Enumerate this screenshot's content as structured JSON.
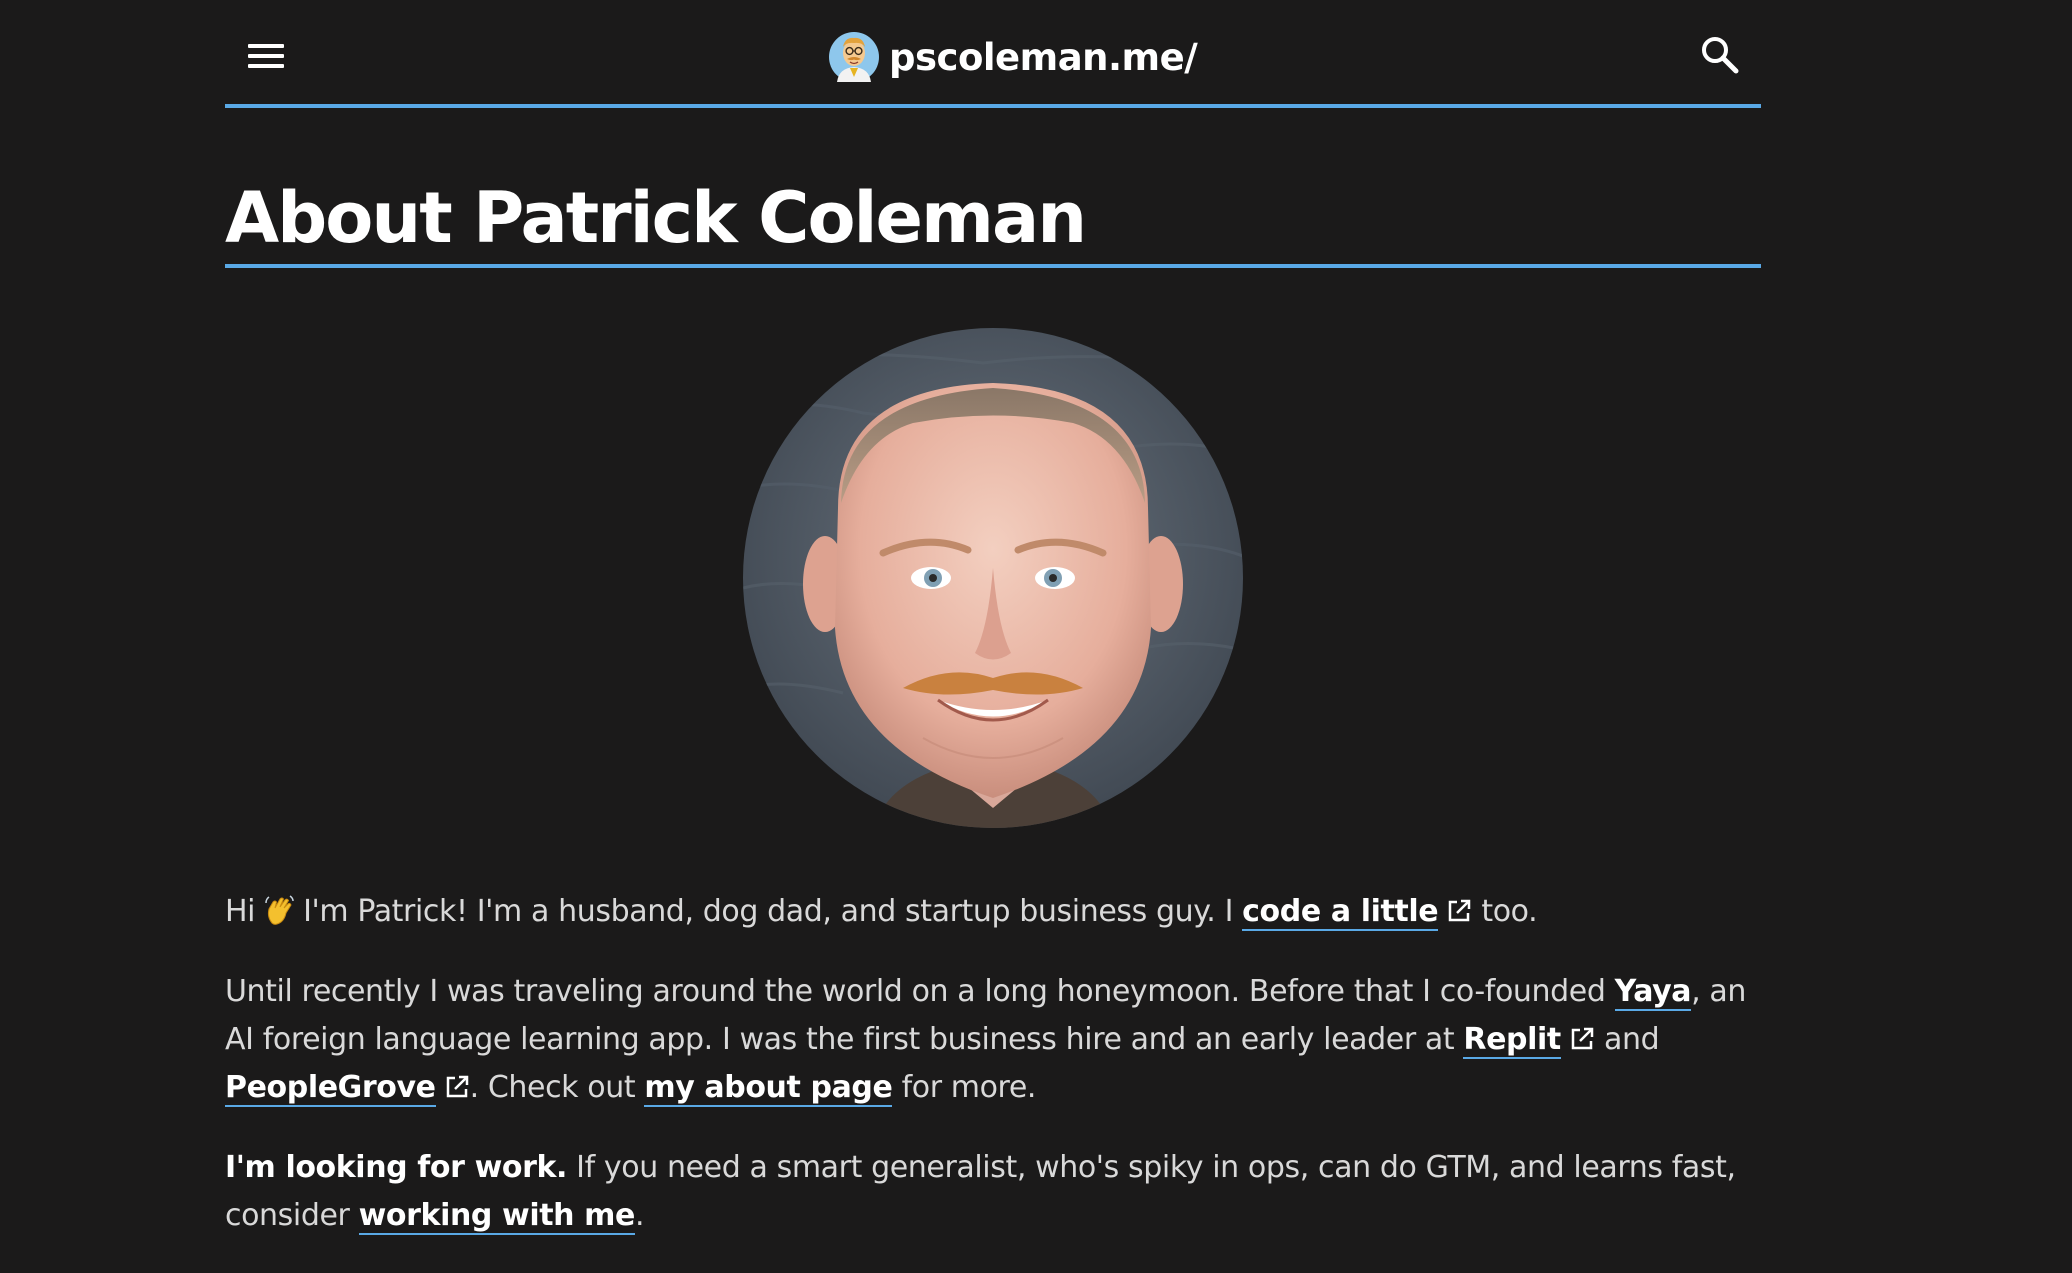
{
  "header": {
    "site_name": "pscoleman.me/",
    "menu_icon": "hamburger-menu-icon",
    "search_icon": "search-icon"
  },
  "page": {
    "title": "About Patrick Coleman"
  },
  "intro": {
    "hi": "Hi",
    "wave_icon": "waving-hand-emoji",
    "text_1": "I'm Patrick! I'm a husband, dog dad, and startup business guy. I ",
    "link_code": "code a little",
    "text_2": " too."
  },
  "bio": {
    "text_1": "Until recently I was traveling around the world on a long honeymoon. Before that I co-founded ",
    "link_yaya": "Yaya",
    "text_2": ", an AI foreign language learning app. I was the first business hire and an early leader at ",
    "link_replit": "Replit",
    "text_3": " and ",
    "link_peoplegrove": "PeopleGrove",
    "text_4": ". Check out ",
    "link_about": "my about page",
    "text_5": " for more."
  },
  "work": {
    "bold": "I'm looking for work.",
    "text_1": " If you need a smart generalist, who's spiky in ops, can do GTM, and learns fast, consider ",
    "link_work": "working with me",
    "text_2": "."
  },
  "colors": {
    "background": "#1b1a1a",
    "accent": "#5aa9e6",
    "link": "#ffffff",
    "text": "#d9d9d9"
  }
}
